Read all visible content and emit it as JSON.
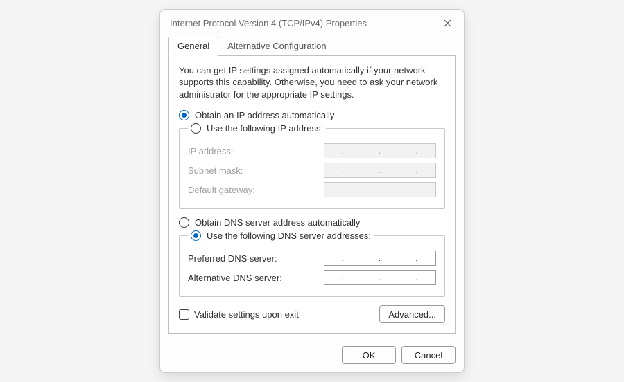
{
  "window": {
    "title": "Internet Protocol Version 4 (TCP/IPv4) Properties"
  },
  "tabs": {
    "general": "General",
    "alt": "Alternative Configuration"
  },
  "description": "You can get IP settings assigned automatically if your network supports this capability. Otherwise, you need to ask your network administrator for the appropriate IP settings.",
  "ip_section": {
    "auto_label": "Obtain an IP address automatically",
    "manual_label": "Use the following IP address:",
    "ip_address_label": "IP address:",
    "subnet_label": "Subnet mask:",
    "gateway_label": "Default gateway:"
  },
  "dns_section": {
    "auto_label": "Obtain DNS server address automatically",
    "manual_label": "Use the following DNS server addresses:",
    "preferred_label": "Preferred DNS server:",
    "alternative_label": "Alternative DNS server:"
  },
  "validate_label": "Validate settings upon exit",
  "buttons": {
    "advanced": "Advanced...",
    "ok": "OK",
    "cancel": "Cancel"
  }
}
